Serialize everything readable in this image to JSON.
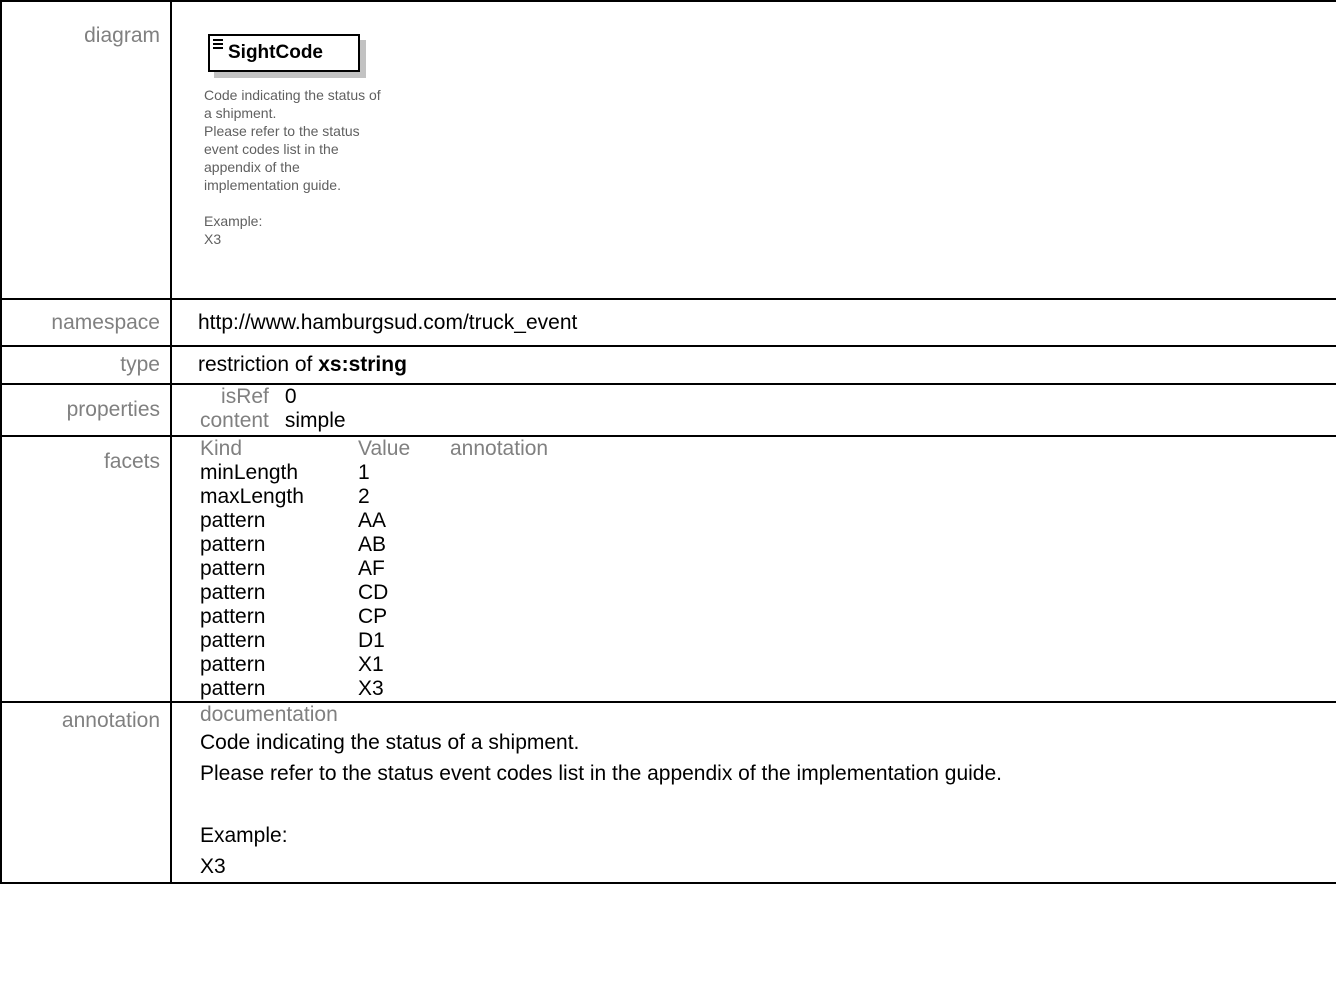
{
  "rows": {
    "diagram": {
      "label": "diagram",
      "element_name": "SightCode",
      "doc_text": "Code indicating the status of\na shipment.\nPlease refer to the status\nevent codes list in the\nappendix of the\nimplementation guide.\n\nExample:\nX3"
    },
    "namespace": {
      "label": "namespace",
      "value": "http://www.hamburgsud.com/truck_event"
    },
    "type": {
      "label": "type",
      "prefix": "restriction of ",
      "base": "xs:string"
    },
    "properties": {
      "label": "properties",
      "items": [
        {
          "key": "isRef",
          "value": "0"
        },
        {
          "key": "content",
          "value": "simple"
        }
      ]
    },
    "facets": {
      "label": "facets",
      "headers": [
        "Kind",
        "Value",
        "annotation"
      ],
      "items": [
        {
          "kind": "minLength",
          "value": "1"
        },
        {
          "kind": "maxLength",
          "value": "2"
        },
        {
          "kind": "pattern",
          "value": "AA"
        },
        {
          "kind": "pattern",
          "value": "AB"
        },
        {
          "kind": "pattern",
          "value": "AF"
        },
        {
          "kind": "pattern",
          "value": "CD"
        },
        {
          "kind": "pattern",
          "value": "CP"
        },
        {
          "kind": "pattern",
          "value": "D1"
        },
        {
          "kind": "pattern",
          "value": "X1"
        },
        {
          "kind": "pattern",
          "value": "X3"
        }
      ]
    },
    "annotation": {
      "label": "annotation",
      "heading": "documentation",
      "text": "Code indicating the status of a shipment.\nPlease refer to the status event codes list in the appendix of the implementation guide.\n\nExample:\nX3"
    }
  }
}
